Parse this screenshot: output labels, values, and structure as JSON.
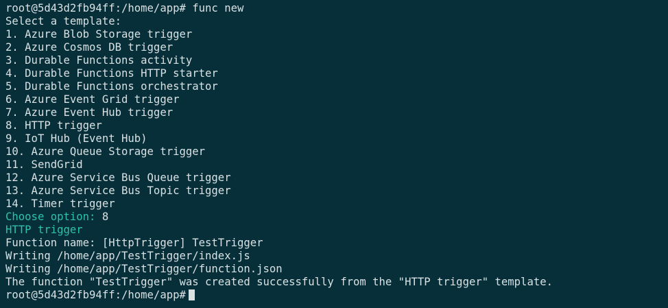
{
  "terminal": {
    "lines": [
      "root@5d43d2fb94ff:/home/app# func new",
      "Select a template:",
      "1. Azure Blob Storage trigger",
      "2. Azure Cosmos DB trigger",
      "3. Durable Functions activity",
      "4. Durable Functions HTTP starter",
      "5. Durable Functions orchestrator",
      "6. Azure Event Grid trigger",
      "7. Azure Event Hub trigger",
      "8. HTTP trigger",
      "9. IoT Hub (Event Hub)",
      "10. Azure Queue Storage trigger",
      "11. SendGrid",
      "12. Azure Service Bus Queue trigger",
      "13. Azure Service Bus Topic trigger",
      "14. Timer trigger"
    ],
    "choose_label": "Choose option:",
    "choose_value": "8",
    "selected_template": "HTTP trigger",
    "output_lines": [
      "Function name: [HttpTrigger] TestTrigger",
      "Writing /home/app/TestTrigger/index.js",
      "Writing /home/app/TestTrigger/function.json",
      "The function \"TestTrigger\" was created successfully from the \"HTTP trigger\" template."
    ],
    "prompt": "root@5d43d2fb94ff:/home/app#"
  },
  "colors": {
    "background": "#062f39",
    "foreground": "#d9e1e3",
    "accent": "#2fc1ad"
  }
}
